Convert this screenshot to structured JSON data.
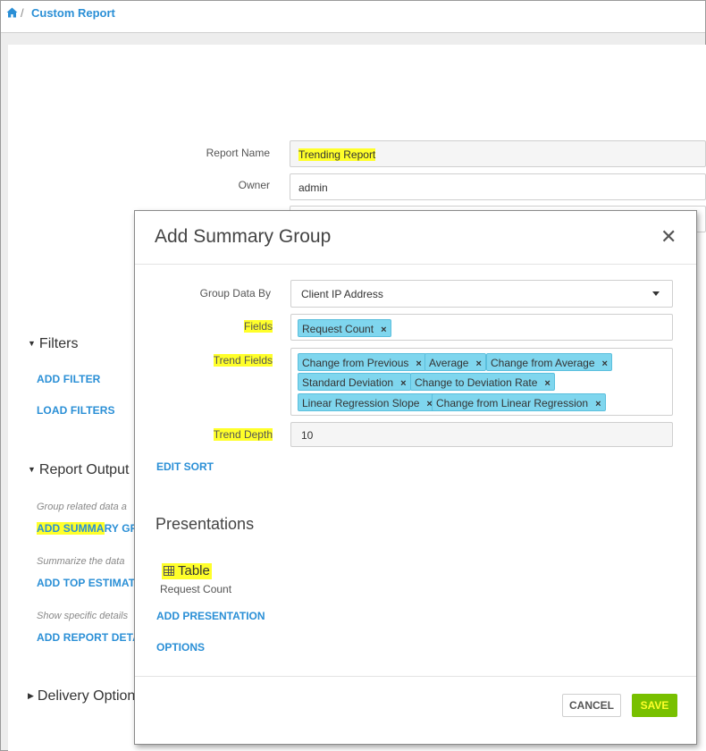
{
  "breadcrumb": {
    "home_icon": "home-icon",
    "separator": "/",
    "title": "Custom Report"
  },
  "form": {
    "report_name_label": "Report Name",
    "report_name_value": "Trending Report",
    "owner_label": "Owner",
    "owner_value": "admin"
  },
  "sidebar": {
    "filters_heading": "Filters",
    "add_filter": "ADD FILTER",
    "load_filters": "LOAD FILTERS",
    "report_output_heading": "Report Output",
    "hint_group": "Group related data a",
    "add_summary_highlight": "ADD SUMMA",
    "add_summary_rest": "RY GR",
    "hint_summarize": "Summarize the data",
    "add_top_estimates": "ADD TOP ESTIMATE",
    "hint_show": "Show specific details",
    "add_report_details": "ADD REPORT DETA",
    "delivery_heading": "Delivery Option"
  },
  "modal": {
    "title": "Add Summary Group",
    "close_icon": "close-icon",
    "group_by_label": "Group Data By",
    "group_by_value": "Client IP Address",
    "fields_label": "Fields",
    "fields": [
      "Request Count"
    ],
    "trend_fields_label": "Trend Fields",
    "trend_fields": [
      "Change from Previous",
      "Average",
      "Change from Average",
      "Standard Deviation",
      "Change to Deviation Rate",
      "Linear Regression Slope",
      "Change from Linear Regression"
    ],
    "trend_depth_label": "Trend Depth",
    "trend_depth_value": "10",
    "edit_sort": "EDIT SORT",
    "presentations_heading": "Presentations",
    "presentation_table_label": "Table",
    "presentation_table_sub": "Request Count",
    "add_presentation": "ADD PRESENTATION",
    "options": "OPTIONS",
    "cancel": "CANCEL",
    "save": "SAVE"
  },
  "colors": {
    "accent": "#2a8fd6",
    "tag": "#7fd6ee",
    "save": "#78c000",
    "highlight": "#ffff2a"
  }
}
